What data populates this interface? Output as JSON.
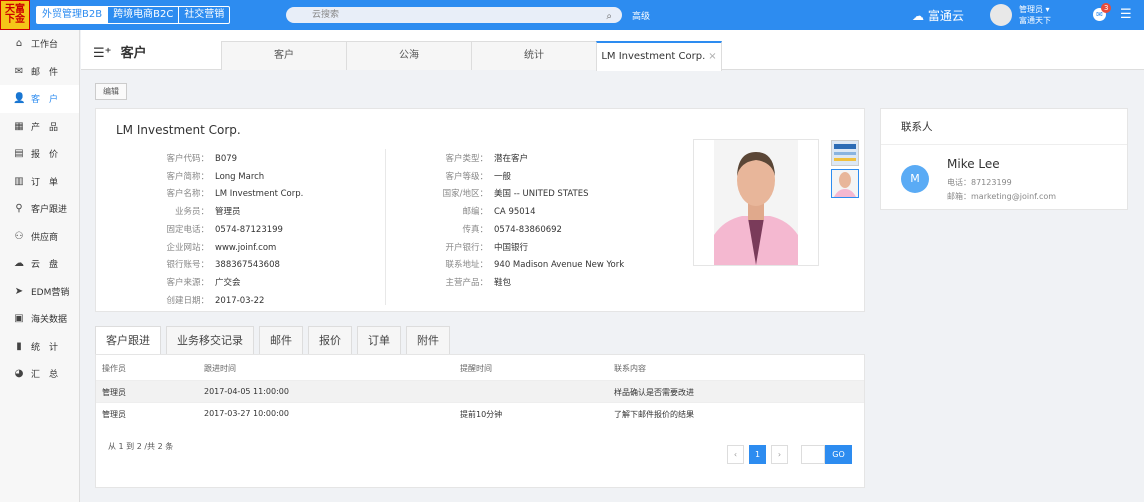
{
  "topbar": {
    "logo_text": "天富下金",
    "nav": [
      "外贸管理B2B",
      "跨境电商B2C",
      "社交营销"
    ],
    "search_placeholder": "云搜索",
    "advanced": "高级",
    "cloud_label": "富通云",
    "user_name": "管理员 ▾",
    "user_company": "富通天下",
    "message_count": "3"
  },
  "sidebar": {
    "items": [
      {
        "label": "工作台",
        "icon": "home-icon",
        "glyph": "⌂"
      },
      {
        "label": "邮　件",
        "icon": "mail-icon",
        "glyph": "✉"
      },
      {
        "label": "客　户",
        "icon": "user-icon",
        "glyph": "👤"
      },
      {
        "label": "产　品",
        "icon": "grid-icon",
        "glyph": "▦"
      },
      {
        "label": "报　价",
        "icon": "quote-icon",
        "glyph": "▤"
      },
      {
        "label": "订　单",
        "icon": "order-icon",
        "glyph": "▥"
      },
      {
        "label": "客户跟进",
        "icon": "pin-icon",
        "glyph": "⚲"
      },
      {
        "label": "供应商",
        "icon": "supplier-icon",
        "glyph": "⚇"
      },
      {
        "label": "云　盘",
        "icon": "cloud-icon",
        "glyph": "☁"
      },
      {
        "label": "EDM营销",
        "icon": "send-icon",
        "glyph": "➤"
      },
      {
        "label": "海关数据",
        "icon": "customs-icon",
        "glyph": "▣"
      },
      {
        "label": "统　计",
        "icon": "stats-icon",
        "glyph": "▮"
      },
      {
        "label": "汇　总",
        "icon": "pie-icon",
        "glyph": "◕"
      }
    ]
  },
  "header": {
    "title": "客户",
    "tabs": [
      "客户",
      "公海",
      "统计",
      "LM Investment Corp."
    ],
    "close_glyph": "×"
  },
  "edit_label": "编辑",
  "customer": {
    "name": "LM Investment Corp.",
    "left_fields": [
      {
        "label": "客户代码：",
        "value": "B079"
      },
      {
        "label": "客户简称：",
        "value": "Long March"
      },
      {
        "label": "客户名称：",
        "value": "LM Investment Corp."
      },
      {
        "label": "业务员：",
        "value": "管理员"
      },
      {
        "label": "固定电话：",
        "value": "0574-87123199"
      },
      {
        "label": "企业网站：",
        "value": "www.joinf.com"
      },
      {
        "label": "银行账号：",
        "value": "388367543608"
      },
      {
        "label": "客户来源：",
        "value": "广交会"
      },
      {
        "label": "创建日期：",
        "value": "2017-03-22"
      }
    ],
    "right_fields": [
      {
        "label": "客户类型：",
        "value": "潜在客户"
      },
      {
        "label": "客户等级：",
        "value": "一般"
      },
      {
        "label": "国家/地区：",
        "value": "美国 -- UNITED STATES"
      },
      {
        "label": "邮编：",
        "value": "CA 95014"
      },
      {
        "label": "传真：",
        "value": "0574-83860692"
      },
      {
        "label": "开户银行：",
        "value": "中国银行"
      },
      {
        "label": "联系地址：",
        "value": "940 Madison Avenue New York"
      },
      {
        "label": "主营产品：",
        "value": "鞋包"
      }
    ]
  },
  "contacts": {
    "header": "联系人",
    "avatar_letter": "M",
    "name": "Mike Lee",
    "phone": "电话：87123199",
    "email": "邮箱：marketing@joinf.com"
  },
  "bottom_tabs": [
    "客户跟进",
    "业务移交记录",
    "邮件",
    "报价",
    "订单",
    "附件"
  ],
  "followup_table": {
    "columns": [
      "操作员",
      "跟进时间",
      "提醒时间",
      "联系内容"
    ],
    "rows": [
      [
        "管理员",
        "2017-04-05 11:00:00",
        "",
        "样品确认是否需要改进"
      ],
      [
        "管理员",
        "2017-03-27 10:00:00",
        "提前10分钟",
        "了解下邮件报价的结果"
      ]
    ],
    "pagination_info": "从 1 到 2 /共 2 条",
    "current_page": "1",
    "prev": "‹",
    "next": "›",
    "go": "GO"
  }
}
